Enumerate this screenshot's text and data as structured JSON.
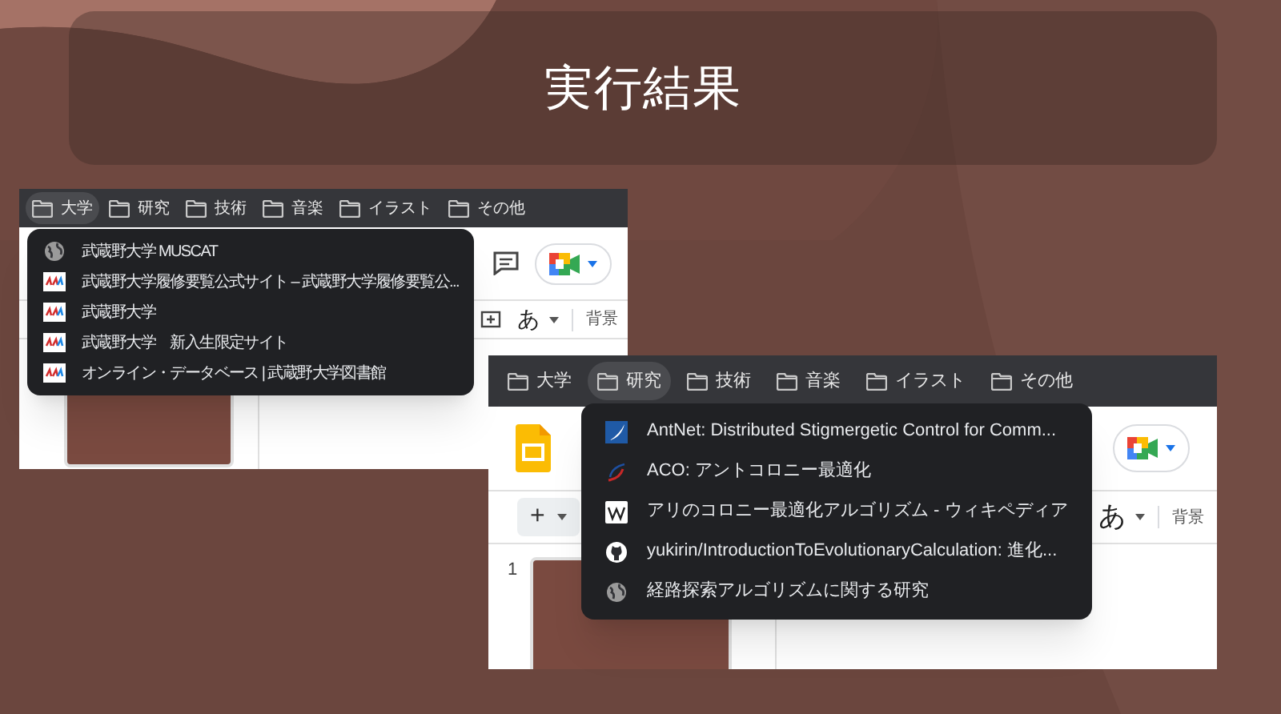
{
  "title": "実行結果",
  "screenshots": [
    {
      "bookmarks": [
        {
          "label": "大学",
          "selected": true
        },
        {
          "label": "研究",
          "selected": false
        },
        {
          "label": "技術",
          "selected": false
        },
        {
          "label": "音楽",
          "selected": false
        },
        {
          "label": "イラスト",
          "selected": false
        },
        {
          "label": "その他",
          "selected": false
        }
      ],
      "menu": [
        {
          "kind": "globe",
          "label": "武蔵野大学 MUSCAT"
        },
        {
          "kind": "university",
          "label": "武蔵野大学履修要覧公式サイト – 武蔵野大学履修要覧公..."
        },
        {
          "kind": "university",
          "label": "武蔵野大学"
        },
        {
          "kind": "university",
          "label": "武蔵野大学　新入生限定サイト"
        },
        {
          "kind": "university",
          "label": "オンライン・データベース | 武蔵野大学図書館"
        }
      ],
      "input_tool": "あ",
      "background_button": "背景"
    },
    {
      "bookmarks": [
        {
          "label": "大学",
          "selected": false
        },
        {
          "label": "研究",
          "selected": true
        },
        {
          "label": "技術",
          "selected": false
        },
        {
          "label": "音楽",
          "selected": false
        },
        {
          "label": "イラスト",
          "selected": false
        },
        {
          "label": "その他",
          "selected": false
        }
      ],
      "menu": [
        {
          "kind": "antnet",
          "label": "AntNet: Distributed Stigmergetic Control for Comm..."
        },
        {
          "kind": "swoosh",
          "label": "ACO: アントコロニー最適化"
        },
        {
          "kind": "wiki",
          "label": "アリのコロニー最適化アルゴリズム - ウィキペディア"
        },
        {
          "kind": "github",
          "label": "yukirin/IntroductionToEvolutionaryCalculation: 進化..."
        },
        {
          "kind": "globe",
          "label": "経路探索アルゴリズムに関する研究"
        }
      ],
      "add_button": "+",
      "input_tool": "あ",
      "background_button": "背景",
      "slide_number": "1"
    }
  ]
}
